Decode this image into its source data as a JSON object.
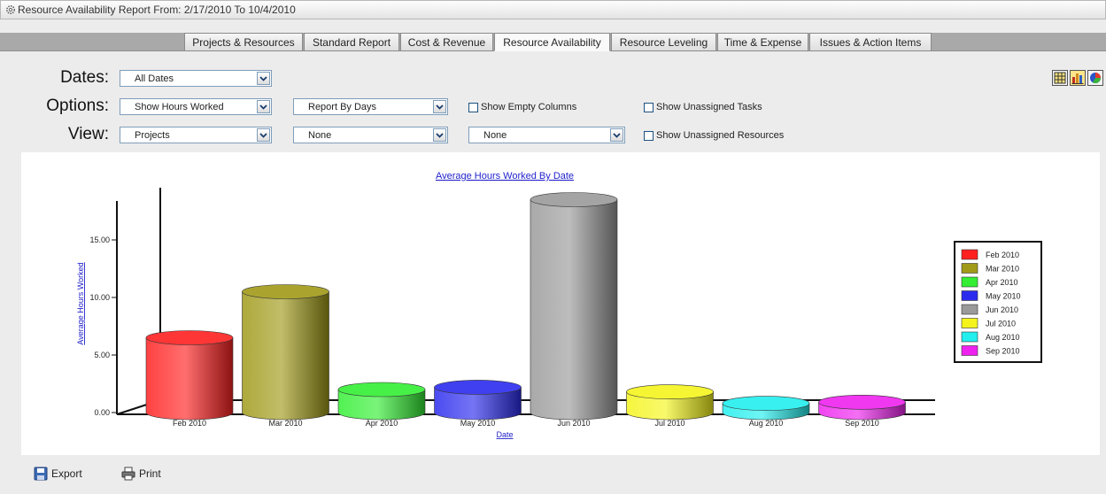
{
  "window": {
    "title": "Resource Availability Report From: 2/17/2010 To 10/4/2010"
  },
  "tabs": [
    {
      "label": "Projects & Resources"
    },
    {
      "label": "Standard Report"
    },
    {
      "label": "Cost & Revenue"
    },
    {
      "label": "Resource Availability",
      "active": true
    },
    {
      "label": "Resource Leveling"
    },
    {
      "label": "Time & Expense"
    },
    {
      "label": "Issues & Action Items"
    }
  ],
  "filters": {
    "dates_label": "Dates:",
    "options_label": "Options:",
    "view_label": "View:",
    "dates_value": "All Dates",
    "options_value": "Show Hours Worked",
    "report_by_value": "Report By Days",
    "view_value": "Projects",
    "view2_value": "None",
    "view3_value": "None",
    "show_empty_columns": "Show Empty Columns",
    "show_unassigned_tasks": "Show Unassigned Tasks",
    "show_unassigned_resources": "Show Unassigned Resources"
  },
  "view_icons": [
    "grid-view-icon",
    "bar-chart-icon",
    "pie-chart-icon"
  ],
  "footer": {
    "export_label": "Export",
    "print_label": "Print"
  },
  "chart_data": {
    "type": "bar",
    "title": "Average Hours Worked By Date",
    "xlabel": "Date",
    "ylabel": "Average Hours Worked",
    "categories": [
      "Feb 2010",
      "Mar 2010",
      "Apr 2010",
      "May 2010",
      "Jun 2010",
      "Jul 2010",
      "Aug 2010",
      "Sep 2010"
    ],
    "values": [
      6.5,
      10.5,
      2.0,
      2.2,
      18.5,
      1.8,
      0.8,
      0.9
    ],
    "yticks": [
      "0.00",
      "5.00",
      "10.00",
      "15.00"
    ],
    "ylim": [
      0,
      20
    ],
    "colors": [
      "#ff2020",
      "#a09a18",
      "#33ee33",
      "#2b2bee",
      "#9a9a9a",
      "#f4f41c",
      "#22eeee",
      "#ee22ee"
    ],
    "legend": [
      "Feb 2010",
      "Mar 2010",
      "Apr 2010",
      "May 2010",
      "Jun 2010",
      "Jul 2010",
      "Aug 2010",
      "Sep 2010"
    ],
    "legend_position": "right",
    "style": "3d-cylinder",
    "grid": false
  }
}
